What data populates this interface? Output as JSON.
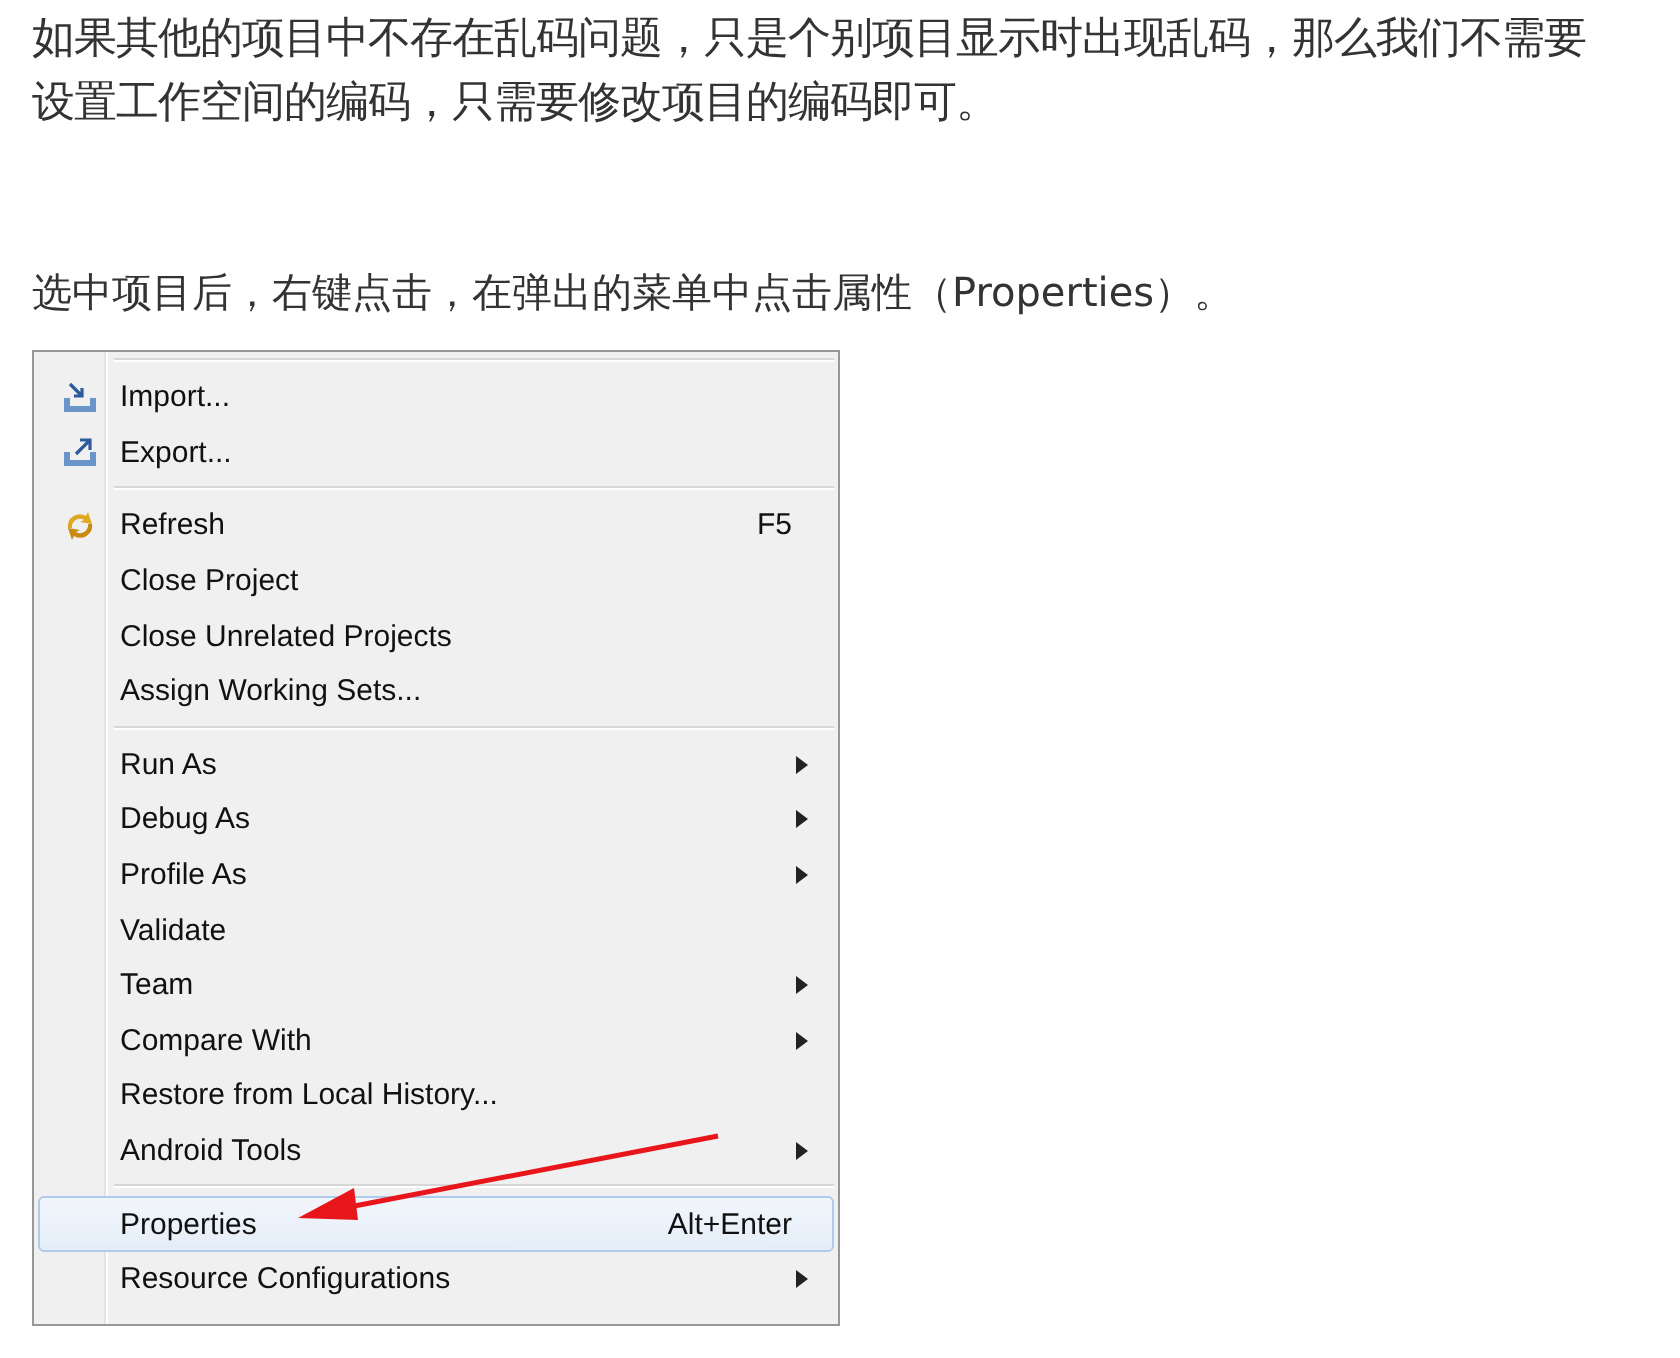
{
  "paragraphs": [
    "如果其他的项目中不存在乱码问题，只是个别项目显示时出现乱码，那么我们不需要设置工作空间的编码，只需要修改项目的编码即可。",
    "选中项目后，右键点击，在弹出的菜单中点击属性（Properties）。"
  ],
  "menu": {
    "groups": [
      [
        {
          "label": "Import...",
          "kind": "import",
          "selected": false,
          "submenu": false
        },
        {
          "label": "Export...",
          "kind": "export",
          "selected": false,
          "submenu": false
        }
      ],
      [
        {
          "label": "Refresh",
          "kind": "refresh",
          "shortcut": "F5",
          "selected": false,
          "submenu": false
        },
        {
          "label": "Close Project",
          "kind": "plain",
          "selected": false,
          "submenu": false
        },
        {
          "label": "Close Unrelated Projects",
          "kind": "plain",
          "selected": false,
          "submenu": false
        },
        {
          "label": "Assign Working Sets...",
          "kind": "plain",
          "selected": false,
          "submenu": false
        }
      ],
      [
        {
          "label": "Run As",
          "kind": "plain",
          "selected": false,
          "submenu": true
        },
        {
          "label": "Debug As",
          "kind": "plain",
          "selected": false,
          "submenu": true
        },
        {
          "label": "Profile As",
          "kind": "plain",
          "selected": false,
          "submenu": true
        },
        {
          "label": "Validate",
          "kind": "plain",
          "selected": false,
          "submenu": false
        },
        {
          "label": "Team",
          "kind": "plain",
          "selected": false,
          "submenu": true
        },
        {
          "label": "Compare With",
          "kind": "plain",
          "selected": false,
          "submenu": true
        },
        {
          "label": "Restore from Local History...",
          "kind": "plain",
          "selected": false,
          "submenu": false
        },
        {
          "label": "Android Tools",
          "kind": "plain",
          "selected": false,
          "submenu": true
        }
      ],
      [
        {
          "label": "Properties",
          "kind": "plain",
          "shortcut": "Alt+Enter",
          "selected": true,
          "submenu": false
        },
        {
          "label": "Resource Configurations",
          "kind": "plain",
          "selected": false,
          "submenu": true
        }
      ]
    ]
  }
}
